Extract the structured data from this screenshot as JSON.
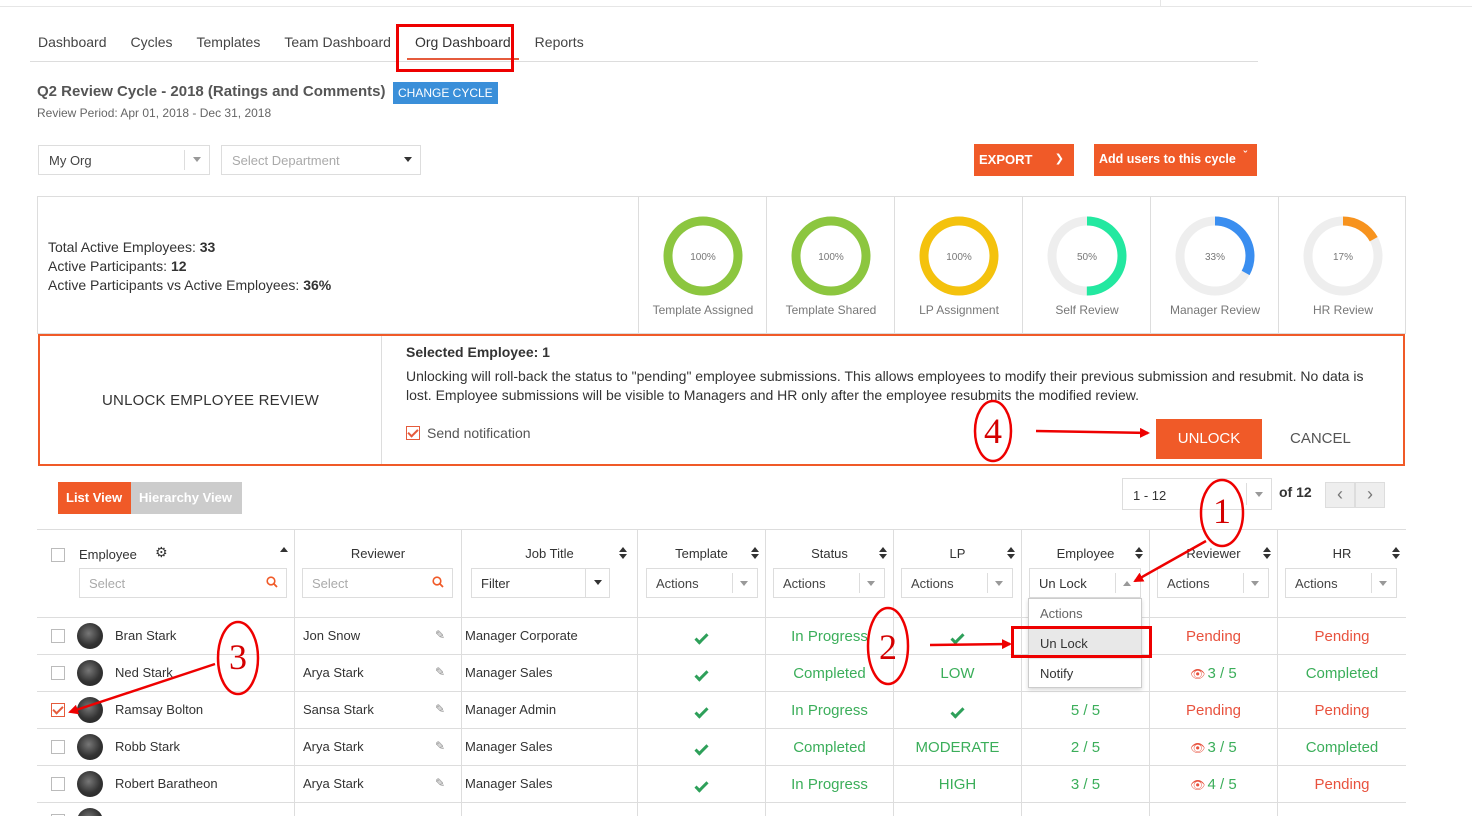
{
  "nav": {
    "items": [
      "Dashboard",
      "Cycles",
      "Templates",
      "Team Dashboard",
      "Org Dashboard",
      "Reports"
    ],
    "active": "Org Dashboard"
  },
  "cycle": {
    "title": "Q2 Review Cycle - 2018 (Ratings and Comments)",
    "change_label": "CHANGE CYCLE",
    "period": "Review Period: Apr 01, 2018 - Dec 31, 2018"
  },
  "filters": {
    "org": "My Org",
    "department_placeholder": "Select Department"
  },
  "toolbar": {
    "export_label": "EXPORT",
    "add_users_label": "Add users to this cycle"
  },
  "stats": {
    "total_label": "Total Active Employees:",
    "total_value": "33",
    "participants_label": "Active Participants:",
    "participants_value": "12",
    "ratio_label": "Active Participants vs Active Employees:",
    "ratio_value": "36%",
    "donuts": [
      {
        "label": "Template Assigned",
        "pct": 100,
        "text": "100%",
        "color": "#8cc63f"
      },
      {
        "label": "Template Shared",
        "pct": 100,
        "text": "100%",
        "color": "#8cc63f"
      },
      {
        "label": "LP Assignment",
        "pct": 100,
        "text": "100%",
        "color": "#f4c20d"
      },
      {
        "label": "Self Review",
        "pct": 50,
        "text": "50%",
        "color": "#23e8a0"
      },
      {
        "label": "Manager Review",
        "pct": 33,
        "text": "33%",
        "color": "#3a8ef0"
      },
      {
        "label": "HR Review",
        "pct": 17,
        "text": "17%",
        "color": "#f7931e"
      }
    ]
  },
  "unlock": {
    "title": "UNLOCK EMPLOYEE REVIEW",
    "selected": "Selected Employee: 1",
    "message": "Unlocking will roll-back the status to \"pending\" employee submissions. This allows employees to modify their previous submission and resubmit. No data is lost. Employee submissions will be visible to Managers and HR only after the employee resubmits the modified review.",
    "notification_label": "Send notification",
    "unlock_label": "UNLOCK",
    "cancel_label": "CANCEL"
  },
  "views": {
    "list": "List View",
    "hierarchy": "Hierarchy View"
  },
  "pager": {
    "range": "1 - 12",
    "of": "of 12"
  },
  "table": {
    "headers": {
      "employee": "Employee",
      "reviewer": "Reviewer",
      "job_title": "Job Title",
      "template": "Template",
      "status": "Status",
      "lp": "LP",
      "employee_col": "Employee",
      "reviewer_col": "Reviewer",
      "hr": "HR"
    },
    "inputs": {
      "employee_placeholder": "Select",
      "reviewer_placeholder": "Select",
      "job_filter": "Filter",
      "actions": "Actions",
      "employee_action": "Un Lock"
    },
    "rows": [
      {
        "name": "Bran Stark",
        "reviewer": "Jon Snow",
        "job": "Manager Corporate",
        "status": "In Progress",
        "lp": "",
        "emp": "",
        "rev": "Pending",
        "rev_eye": false,
        "hr": "Pending",
        "checked": false
      },
      {
        "name": "Ned Stark",
        "reviewer": "Arya Stark",
        "job": "Manager Sales",
        "status": "Completed",
        "lp": "LOW",
        "emp": "",
        "rev": "3 / 5",
        "rev_eye": true,
        "hr": "Completed",
        "checked": false
      },
      {
        "name": "Ramsay Bolton",
        "reviewer": "Sansa Stark",
        "job": "Manager Admin",
        "status": "In Progress",
        "lp": "",
        "emp": "5 / 5",
        "rev": "Pending",
        "rev_eye": false,
        "hr": "Pending",
        "checked": true
      },
      {
        "name": "Robb Stark",
        "reviewer": "Arya Stark",
        "job": "Manager Sales",
        "status": "Completed",
        "lp": "MODERATE",
        "emp": "2 / 5",
        "rev": "3 / 5",
        "rev_eye": true,
        "hr": "Completed",
        "checked": false
      },
      {
        "name": "Robert Baratheon",
        "reviewer": "Arya Stark",
        "job": "Manager Sales",
        "status": "In Progress",
        "lp": "HIGH",
        "emp": "3 / 5",
        "rev": "4 / 5",
        "rev_eye": true,
        "hr": "Pending",
        "checked": false
      }
    ]
  },
  "dropdown": {
    "items": [
      "Actions",
      "Un Lock",
      "Notify"
    ],
    "selected": "Un Lock"
  },
  "annotations": {
    "n1": "1",
    "n2": "2",
    "n3": "3",
    "n4": "4"
  },
  "colors": {
    "accent": "#f05a28",
    "link_blue": "#3a8fd9",
    "green": "#3bae5a",
    "red": "#e8523e",
    "annotation": "#d40000"
  }
}
